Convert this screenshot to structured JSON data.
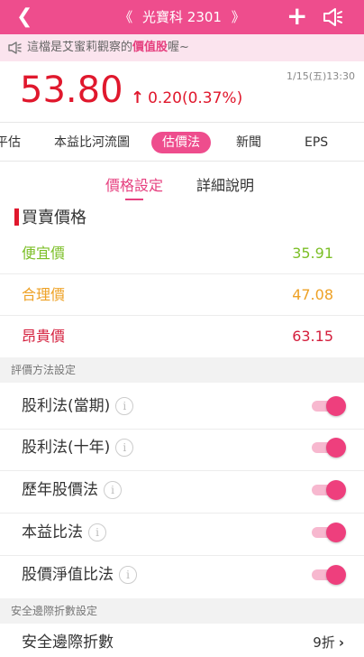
{
  "topbar": {
    "back_icon": "back-chevron-icon",
    "title_left": "《",
    "title": "光寶科 2301",
    "title_right": "》",
    "add_icon": "plus-icon",
    "speaker_icon": "speaker-icon"
  },
  "notice": {
    "icon": "speaker-icon",
    "text_before": "這檔是艾蜜莉觀察的",
    "highlight": "價值股",
    "text_after": "喔~"
  },
  "quote": {
    "price": "53.80",
    "change_arrow": "↑",
    "change": "0.20(0.37%)",
    "time": "1/15(五)13:30",
    "color": "#e0182d"
  },
  "tabs": [
    {
      "label": "平估"
    },
    {
      "label": "本益比河流圖"
    },
    {
      "label": "估價法",
      "active": true
    },
    {
      "label": "新聞"
    },
    {
      "label": "EPS"
    }
  ],
  "subtabs": [
    {
      "label": "價格設定",
      "active": true
    },
    {
      "label": "詳細說明"
    }
  ],
  "price_section": {
    "title": "買賣價格",
    "rows": [
      {
        "label": "便宜價",
        "value": "35.91",
        "color": "#7cbf27"
      },
      {
        "label": "合理價",
        "value": "47.08",
        "color": "#eea125"
      },
      {
        "label": "昂貴價",
        "value": "63.15",
        "color": "#d41e3c"
      }
    ]
  },
  "method_section": {
    "header": "評價方法設定",
    "info_glyph": "i",
    "rows": [
      {
        "label": "股利法(當期)",
        "enabled": true
      },
      {
        "label": "股利法(十年)",
        "enabled": true
      },
      {
        "label": "歷年股價法",
        "enabled": true
      },
      {
        "label": "本益比法",
        "enabled": true
      },
      {
        "label": "股價淨值比法",
        "enabled": true
      }
    ]
  },
  "safety_section": {
    "header": "安全邊際折數設定",
    "label": "安全邊際折數",
    "value": "9折",
    "chevron": "›"
  },
  "colors": {
    "accent": "#ee4d8d",
    "toggle_on": "#ee3f7d"
  }
}
